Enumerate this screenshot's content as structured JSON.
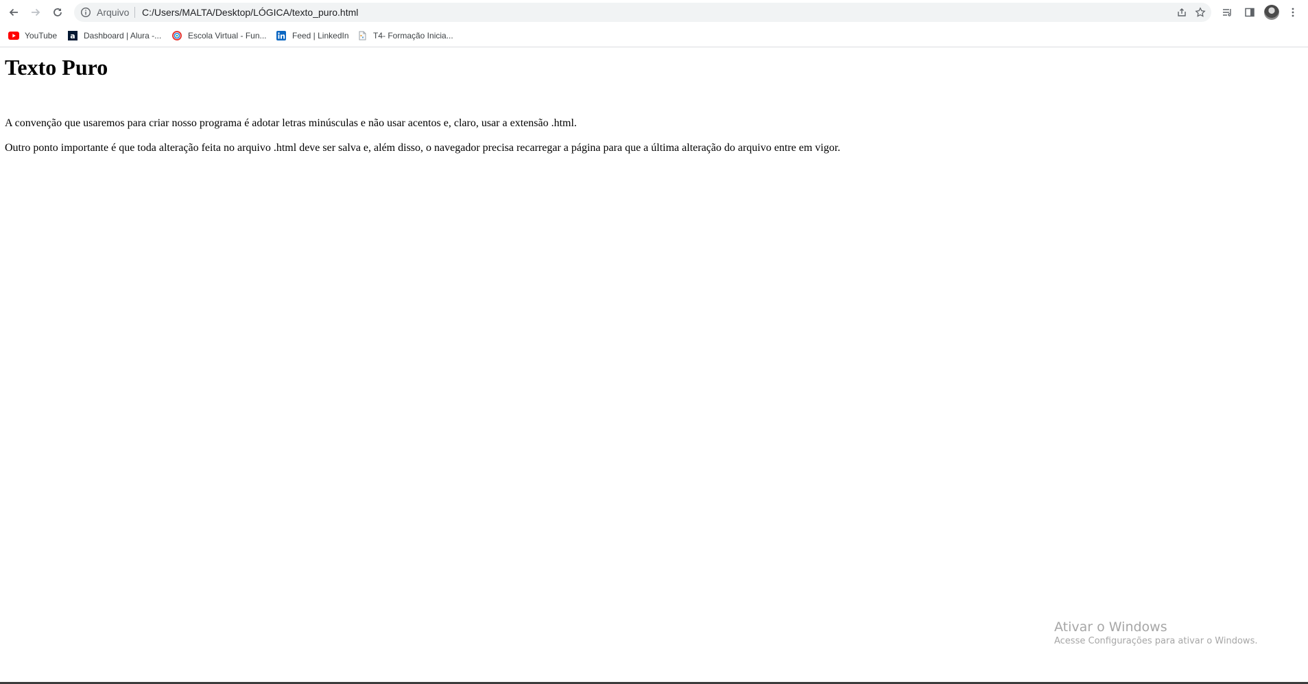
{
  "browser": {
    "address_bar": {
      "scheme_label": "Arquivo",
      "url": "C:/Users/MALTA/Desktop/LÓGICA/texto_puro.html"
    },
    "bookmarks": [
      {
        "label": "YouTube",
        "icon": "youtube-icon"
      },
      {
        "label": "Dashboard | Alura -...",
        "icon": "alura-icon"
      },
      {
        "label": "Escola Virtual - Fun...",
        "icon": "escola-virtual-icon"
      },
      {
        "label": "Feed | LinkedIn",
        "icon": "linkedin-icon"
      },
      {
        "label": "T4- Formação Inicia...",
        "icon": "page-icon"
      }
    ]
  },
  "page": {
    "heading": "Texto Puro",
    "paragraphs": [
      "A convenção que usaremos para criar nosso programa é adotar letras minúsculas e não usar acentos e, claro, usar a extensão .html.",
      "Outro ponto importante é que toda alteração feita no arquivo .html deve ser salva e, além disso, o navegador precisa recarregar a página para que a última alteração do arquivo entre em vigor."
    ]
  },
  "windows_watermark": {
    "title": "Ativar o Windows",
    "subtitle": "Acesse Configurações para ativar o Windows."
  }
}
